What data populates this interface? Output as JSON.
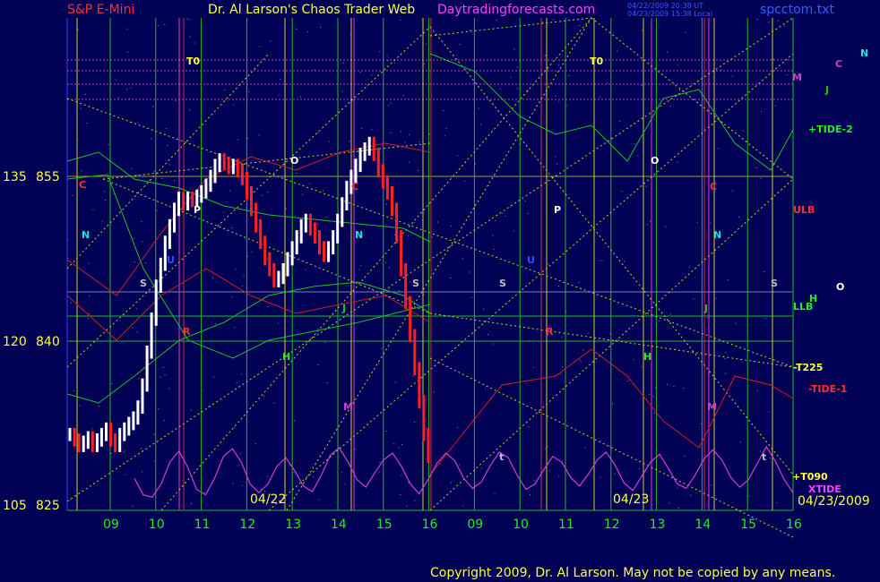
{
  "header": {
    "instrument": "S&P E-Mini",
    "author": "Dr. Al Larson's Chaos Trader Web",
    "site": "Daytradingforecasts.com",
    "timestamp1": "04/22/2009 20:38 UT",
    "timestamp2": "04/23/2009 15:38 Local",
    "file": "spcctom.txt"
  },
  "footer": {
    "copyright": "Copyright 2009, Dr. Al Larson. May not be copied by any means."
  },
  "colors": {
    "background": "#000055",
    "grid_green": "#22b722",
    "grid_yellow": "#d0d02a",
    "price_up": "#ffffff",
    "price_down": "#ff2020",
    "xtide": "#d040d0",
    "tide_green": "#22c022",
    "tide_red": "#d02020"
  },
  "chart_data": {
    "type": "line",
    "title": "S&P E-Mini",
    "y_left_a": {
      "ticks": [
        "135",
        "120",
        "105"
      ]
    },
    "y_left_b": {
      "ticks": [
        "855",
        "840",
        "825"
      ],
      "ylim": [
        825,
        865
      ]
    },
    "x": {
      "hours": [
        "09",
        "10",
        "11",
        "12",
        "13",
        "14",
        "15",
        "16",
        "09",
        "10",
        "11",
        "12",
        "13",
        "14",
        "15",
        "16"
      ],
      "dates": [
        "04/22",
        "04/23"
      ],
      "end_date": "04/23/2009"
    },
    "right_labels": [
      {
        "text": "M",
        "color": "#d040d0"
      },
      {
        "text": "C",
        "color": "#d040d0"
      },
      {
        "text": "N",
        "color": "#20e0e0"
      },
      {
        "text": "J",
        "color": "#22c022"
      },
      {
        "text": "+TIDE-2",
        "color": "#22ee22"
      },
      {
        "text": "ULB",
        "color": "#ff3030"
      },
      {
        "text": "H",
        "color": "#22ee22"
      },
      {
        "text": "O",
        "color": "#ffffff"
      },
      {
        "text": "LLB",
        "color": "#22ee22"
      },
      {
        "text": "-T225",
        "color": "#ffff40"
      },
      {
        "text": "-TIDE-1",
        "color": "#ff3030"
      },
      {
        "text": "+T090",
        "color": "#ffff40"
      },
      {
        "text": "XTIDE",
        "color": "#ff40ff"
      }
    ],
    "markers": [
      {
        "text": "T0",
        "color": "#ffff40"
      },
      {
        "text": "T0",
        "color": "#ffff40"
      },
      {
        "text": "O",
        "color": "#ffffff"
      },
      {
        "text": "O",
        "color": "#ffffff"
      },
      {
        "text": "C",
        "color": "#ff3030"
      },
      {
        "text": "C",
        "color": "#ff3030"
      },
      {
        "text": "C",
        "color": "#ff3030"
      },
      {
        "text": "N",
        "color": "#20e0e0"
      },
      {
        "text": "N",
        "color": "#20e0e0"
      },
      {
        "text": "N",
        "color": "#20e0e0"
      },
      {
        "text": "P",
        "color": "#ffffff"
      },
      {
        "text": "P",
        "color": "#ffffff"
      },
      {
        "text": "U",
        "color": "#3050ff"
      },
      {
        "text": "U",
        "color": "#3050ff"
      },
      {
        "text": "S",
        "color": "#c0c0c0"
      },
      {
        "text": "S",
        "color": "#c0c0c0"
      },
      {
        "text": "S",
        "color": "#c0c0c0"
      },
      {
        "text": "S",
        "color": "#c0c0c0"
      },
      {
        "text": "R",
        "color": "#ff3030"
      },
      {
        "text": "R",
        "color": "#ff3030"
      },
      {
        "text": "J",
        "color": "#22c022"
      },
      {
        "text": "J",
        "color": "#22c022"
      },
      {
        "text": "H",
        "color": "#22ee22"
      },
      {
        "text": "H",
        "color": "#22ee22"
      },
      {
        "text": "M",
        "color": "#d040d0"
      },
      {
        "text": "M",
        "color": "#d040d0"
      },
      {
        "text": "t",
        "color": "#c0c0c0"
      },
      {
        "text": "t",
        "color": "#c0c0c0"
      }
    ],
    "price_series": {
      "name": "S&P E-Mini",
      "values": [
        831.5,
        831,
        830.5,
        830.8,
        831.2,
        830.5,
        831,
        831.5,
        832,
        831,
        830.5,
        831.5,
        832,
        832.5,
        833,
        834,
        836,
        839,
        842,
        845,
        847,
        849,
        850.5,
        852,
        853,
        852.5,
        853,
        852.8,
        853.2,
        853.6,
        854.2,
        855,
        856,
        856.5,
        856.2,
        855.8,
        856,
        855.5,
        854.8,
        853.5,
        852,
        850.5,
        849,
        847.5,
        846.5,
        845.5,
        845.8,
        846.5,
        847.5,
        848.5,
        849.5,
        850.5,
        851,
        850.2,
        849.5,
        848.5,
        847.8,
        848.5,
        849.5,
        851,
        852.5,
        854,
        855,
        856,
        857,
        857.5,
        858,
        857,
        855.5,
        854.5,
        853.5,
        852,
        849.5,
        846.5,
        843.5,
        840.5,
        837.5,
        834.5,
        831.5,
        829.5
      ]
    },
    "xtide_series": {
      "name": "XTIDE",
      "values": [
        827.5,
        826,
        825.8,
        827,
        829,
        830,
        828.5,
        826.5,
        826,
        827.5,
        829.5,
        830.2,
        829,
        827,
        826.2,
        827,
        828.6,
        829.4,
        828.2,
        826.8,
        826.3,
        827.8,
        829.6,
        830.3,
        829,
        827.4,
        826.7,
        828,
        829.2,
        829.8,
        828.6,
        827,
        826.1,
        827.4,
        828.9,
        829.8,
        829.1,
        827.5,
        826.6,
        827.2,
        828.7,
        829.9,
        829.4,
        827.8,
        826.5,
        827,
        828.3,
        829.5,
        829,
        827.6,
        826.8,
        827.9,
        829.2,
        829.9,
        828.7,
        827.1,
        826.4,
        827.7,
        829,
        829.7,
        828.4,
        827,
        826.6,
        827.8,
        829.3,
        830.1,
        829.2,
        827.6,
        826.7,
        827.4,
        828.9,
        830.4,
        829.1,
        827.4,
        826.2
      ]
    },
    "grid": true
  }
}
